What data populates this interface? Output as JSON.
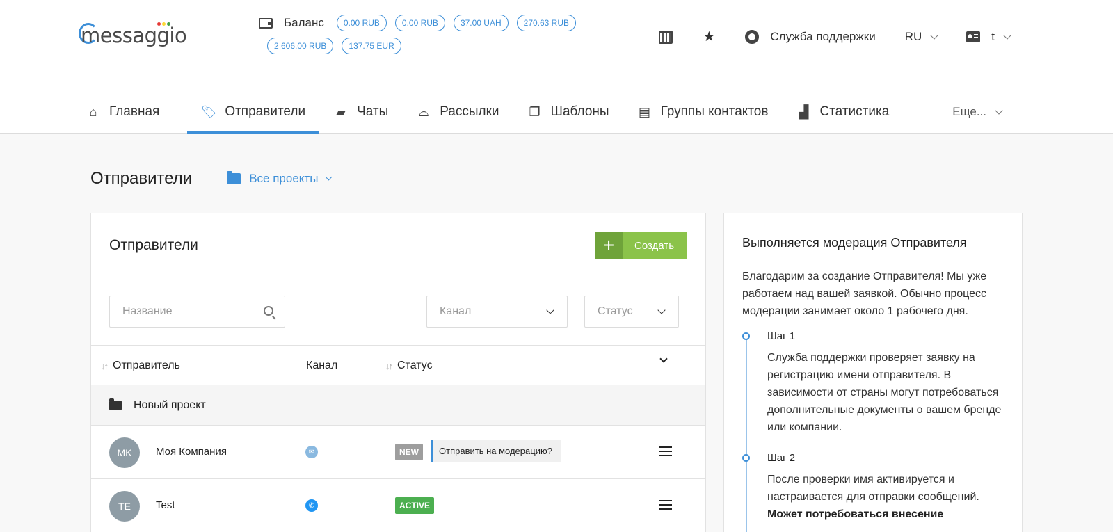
{
  "header": {
    "logo": "messaggio",
    "balance": {
      "label": "Баланс",
      "row1": [
        "0.00 RUB",
        "0.00 RUB",
        "37.00 UAH",
        "270.63 RUB"
      ],
      "row2": [
        "2 606.00 RUB",
        "137.75 EUR"
      ]
    },
    "support": "Служба поддержки",
    "language": "RU",
    "user": "t"
  },
  "nav": {
    "items": [
      "Главная",
      "Отправители",
      "Чаты",
      "Рассылки",
      "Шаблоны",
      "Группы контактов",
      "Статистика"
    ],
    "active": "Отправители",
    "more": "Еще..."
  },
  "page": {
    "title": "Отправители",
    "projects": "Все проекты"
  },
  "card": {
    "title": "Отправители",
    "create": "Создать",
    "search_placeholder": "Название",
    "channel_select": "Канал",
    "status_select": "Статус",
    "columns": {
      "sender": "Отправитель",
      "channel": "Канал",
      "status": "Статус"
    },
    "group": "Новый проект",
    "rows": [
      {
        "initials": "MK",
        "name": "Моя Компания",
        "status": "NEW",
        "tooltip": "Отправить на модерацию?"
      },
      {
        "initials": "TE",
        "name": "Test",
        "status": "ACTIVE"
      }
    ]
  },
  "side": {
    "title": "Выполняется модерация Отправителя",
    "intro": "Благодарим за создание Отправителя! Мы уже работаем над вашей заявкой. Обычно процесс модерации занимает около 1 рабочего дня.",
    "step1_title": "Шаг 1",
    "step1_text": "Служба поддержки проверяет заявку на регистрацию имени отправителя. В зависимости от страны могут потребоваться дополнительные документы о вашем бренде или компании.",
    "step2_title": "Шаг 2",
    "step2_text": "После проверки имя активируется и настраивается для отправки сообщений.",
    "step2_bold": "Может потребоваться внесение"
  },
  "colors": {
    "accent": "#3d8fd8",
    "create": "#8bc34a",
    "status_new": "#9e9e9e",
    "status_active": "#4caf50",
    "email_channel": "#8ab9e0",
    "phone_channel": "#2196f3"
  }
}
